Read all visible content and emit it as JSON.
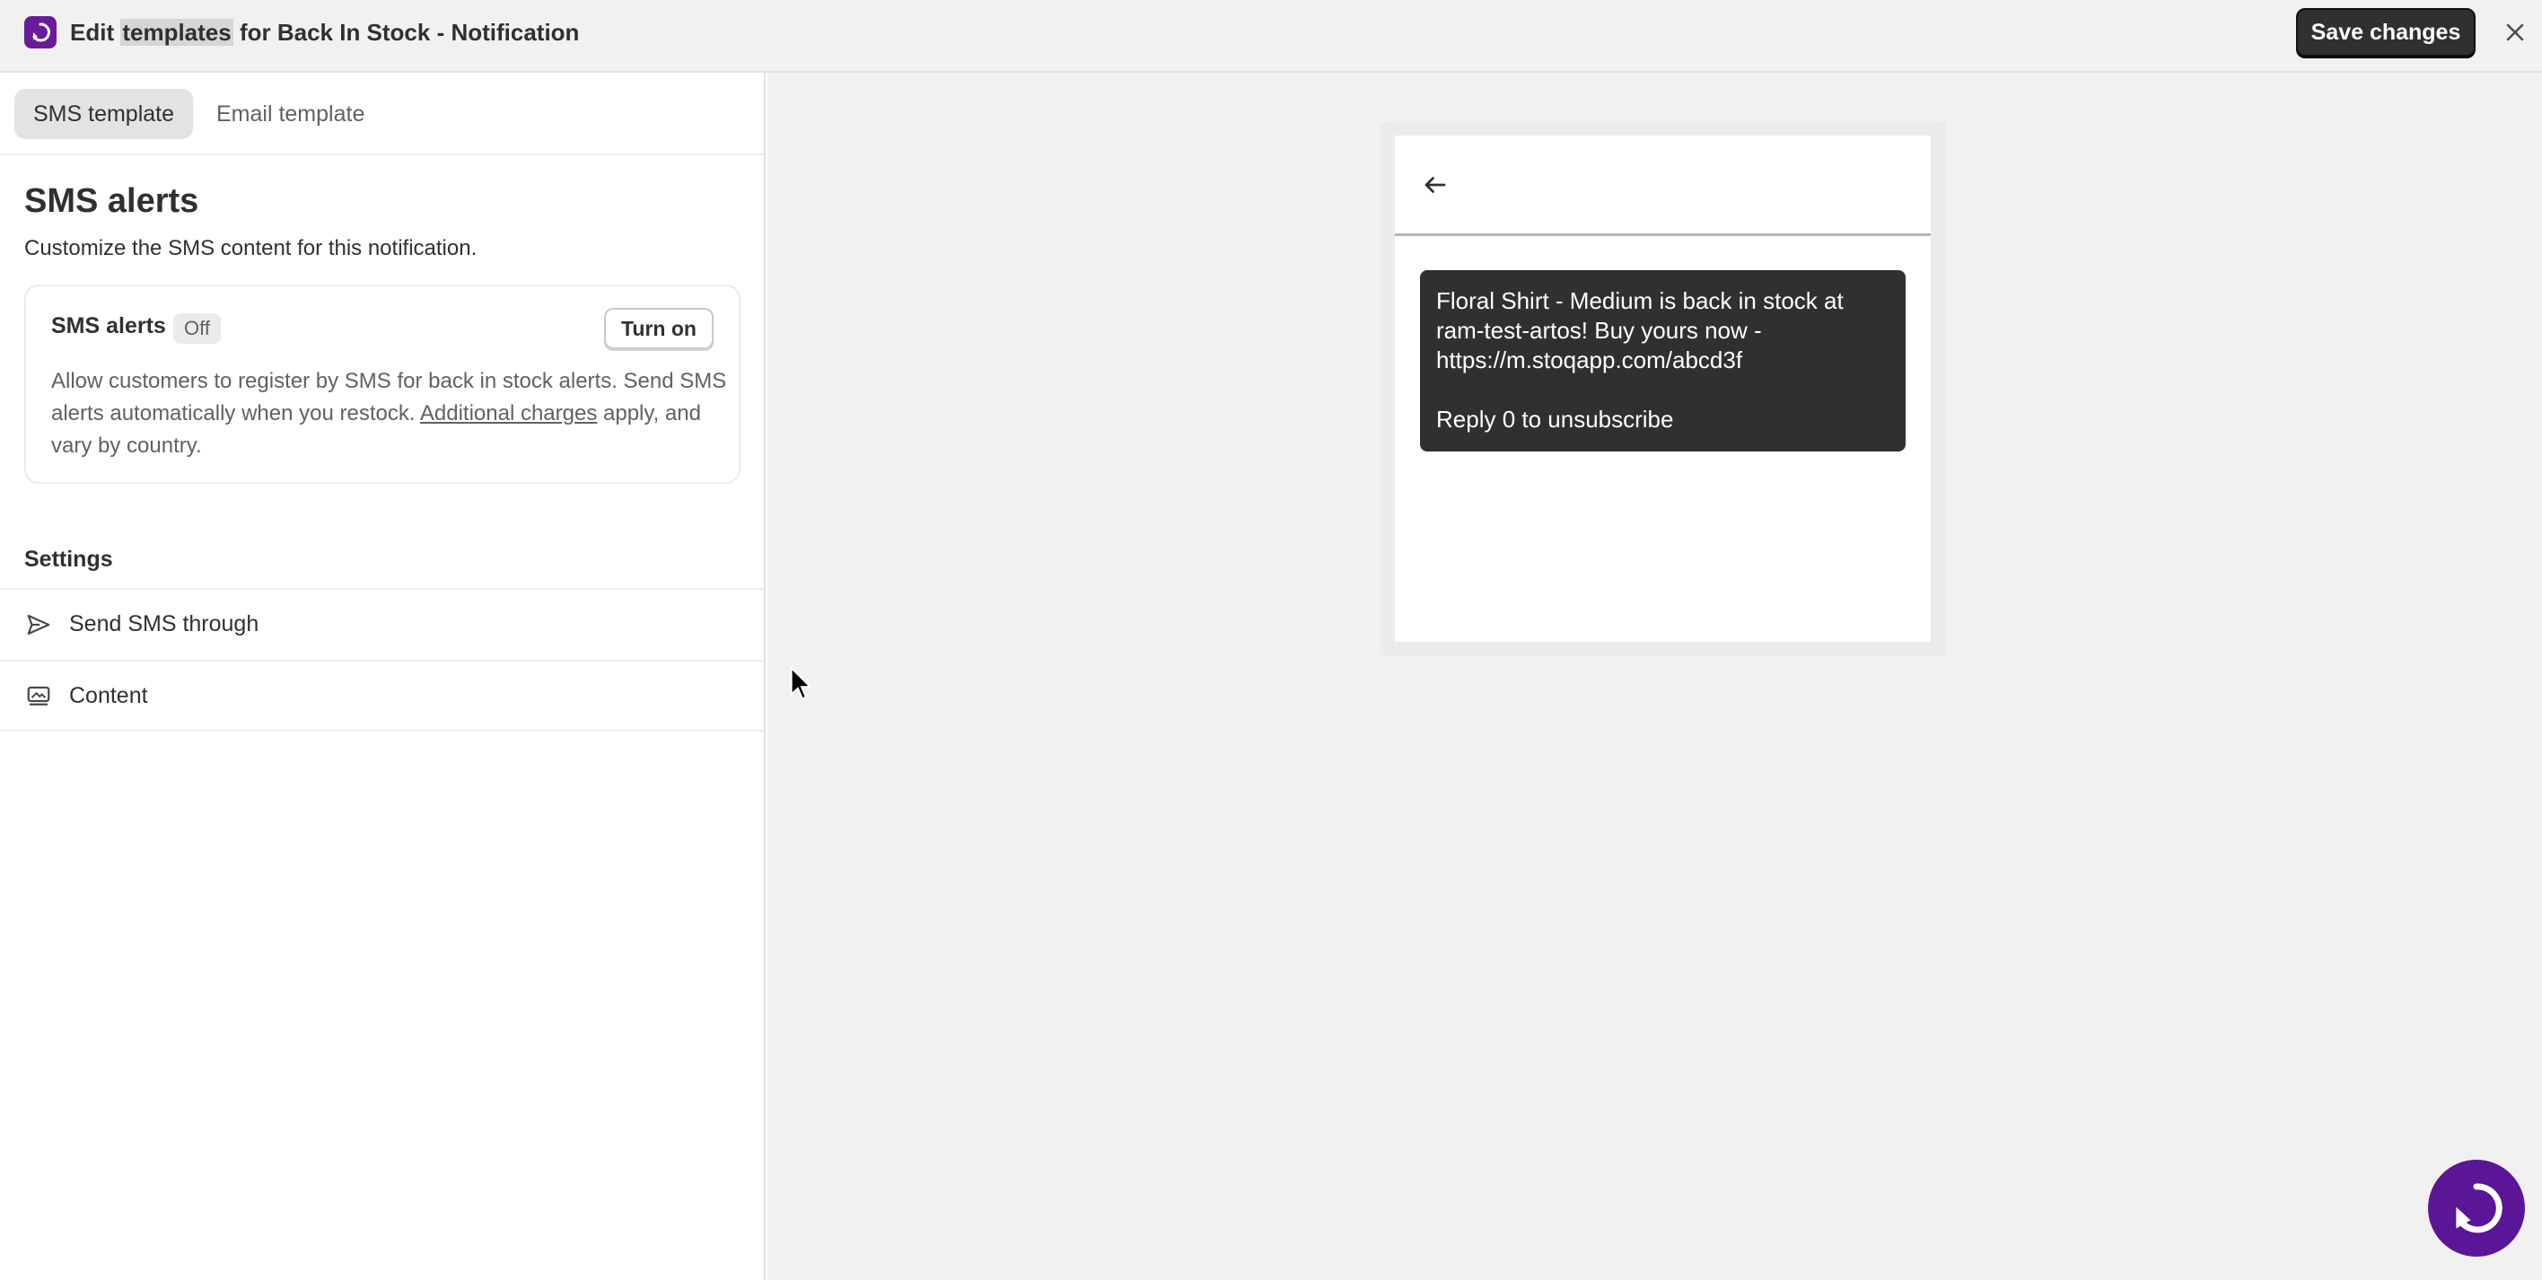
{
  "header": {
    "title_prefix": "Edit ",
    "title_highlight": "templates",
    "title_suffix": " for Back In Stock - Notification",
    "save_label": "Save changes",
    "brand_color": "#6a1b9a"
  },
  "tabs": [
    {
      "label": "SMS template",
      "active": true
    },
    {
      "label": "Email template",
      "active": false
    }
  ],
  "sms_section": {
    "title": "SMS alerts",
    "description": "Customize the SMS content for this notification.",
    "card": {
      "label": "SMS alerts",
      "status": "Off",
      "button_label": "Turn on",
      "body_before_link": "Allow customers to register by SMS for back in stock alerts. Send SMS alerts automatically when you restock. ",
      "link_text": "Additional charges",
      "body_after_link": " apply, and vary by country."
    }
  },
  "settings": {
    "title": "Settings",
    "items": [
      {
        "label": "Send SMS through",
        "icon": "send-icon"
      },
      {
        "label": "Content",
        "icon": "content-icon"
      }
    ]
  },
  "preview": {
    "message_lines": [
      "Floral Shirt - Medium is back in stock at",
      "ram-test-artos! Buy yours now -",
      "https://m.stoqapp.com/abcd3f"
    ],
    "unsubscribe_line": "Reply 0 to unsubscribe"
  },
  "icons": {
    "logo": "stoq-logo-icon",
    "close": "close-icon",
    "back": "arrow-left-icon",
    "fab": "stoq-logo-icon"
  }
}
